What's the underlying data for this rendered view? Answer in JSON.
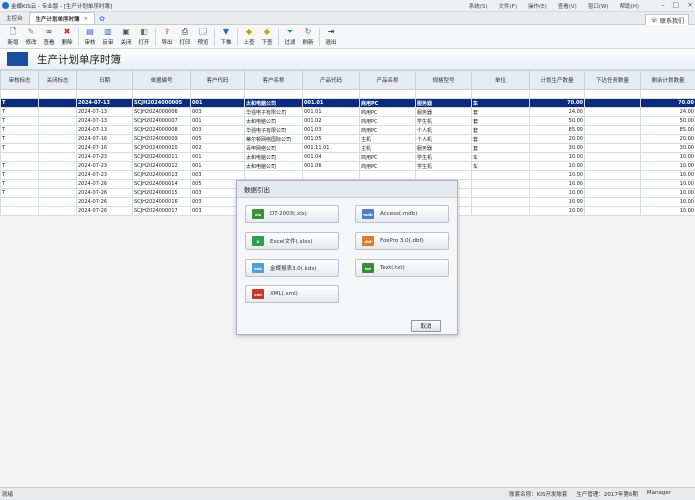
{
  "window": {
    "title": "金蝶KIS云 - 专业版 - [生产计划单序时簿]",
    "menus": [
      "系统(S)",
      "文件(F)",
      "操作(E)",
      "查看(V)",
      "窗口(W)",
      "帮助(H)"
    ]
  },
  "tabs": [
    {
      "label": "主控台",
      "active": false
    },
    {
      "label": "生产计划单序时簿",
      "active": true
    }
  ],
  "contact_label": "联系我们",
  "toolbar": {
    "buttons": [
      {
        "label": "新增",
        "icon": "new-document-icon"
      },
      {
        "label": "修改",
        "icon": "edit-icon"
      },
      {
        "label": "查看",
        "icon": "binoculars-icon"
      },
      {
        "label": "删除",
        "icon": "delete-icon"
      },
      {
        "label": "审核",
        "icon": "audit-icon"
      },
      {
        "label": "反审",
        "icon": "unaudit-icon"
      },
      {
        "label": "关闭",
        "icon": "close-doc-icon"
      },
      {
        "label": "打开",
        "icon": "open-doc-icon"
      },
      {
        "label": "导出",
        "icon": "export-icon"
      },
      {
        "label": "打印",
        "icon": "print-icon"
      },
      {
        "label": "预览",
        "icon": "preview-icon"
      },
      {
        "label": "下推",
        "icon": "push-down-icon"
      },
      {
        "label": "上查",
        "icon": "query-up-icon"
      },
      {
        "label": "下查",
        "icon": "query-down-icon"
      },
      {
        "label": "过滤",
        "icon": "filter-icon"
      },
      {
        "label": "刷新",
        "icon": "refresh-icon"
      },
      {
        "label": "退出",
        "icon": "exit-icon"
      }
    ]
  },
  "page_title": "生产计划单序时簿",
  "grid": {
    "columns": [
      "审核标志",
      "关闭标志",
      "日期",
      "单据编号",
      "客户代码",
      "客户名称",
      "产品代码",
      "产品名称",
      "规格型号",
      "单位",
      "计划生产数量",
      "下达任务数量",
      "剩余计划数量"
    ],
    "rows": [
      [
        "",
        "",
        "",
        "",
        "",
        "",
        "",
        "",
        "",
        "",
        "",
        "",
        ""
      ],
      [
        "T",
        "",
        "2024-07-13",
        "SCJH2024000005",
        "001",
        "太和电脑公司",
        "001.01",
        "商用PC",
        "服务器",
        "车",
        "70.00",
        "",
        "70.00"
      ],
      [
        "T",
        "",
        "2024-07-13",
        "SCJH2024000006",
        "003",
        "华强电子有限公司",
        "001.01",
        "商用PC",
        "服务器",
        "套",
        "24.00",
        "",
        "24.00"
      ],
      [
        "T",
        "",
        "2024-07-13",
        "SCJH2024000007",
        "001",
        "太和电脑公司",
        "001.02",
        "商用PC",
        "学生机",
        "套",
        "50.00",
        "",
        "50.00"
      ],
      [
        "T",
        "",
        "2024-07-13",
        "SCJH2024000008",
        "003",
        "华强电子有限公司",
        "001.03",
        "商用PC",
        "个人机",
        "套",
        "85.00",
        "",
        "85.00"
      ],
      [
        "T",
        "",
        "2024-07-16",
        "SCJH2024000009",
        "005",
        "蒂尔顿网络国际公司",
        "001.05",
        "主机",
        "个人机",
        "套",
        "20.00",
        "",
        "20.00"
      ],
      [
        "T",
        "",
        "2024-07-16",
        "SCJH2024000010",
        "002",
        "百甲网络公司",
        "001.11.01",
        "主机",
        "服务器",
        "套",
        "30.00",
        "",
        "30.00"
      ],
      [
        "",
        "",
        "2024-07-23",
        "SCJH2024000011",
        "001",
        "太和电脑公司",
        "001.04",
        "商用PC",
        "学生机",
        "车",
        "10.00",
        "",
        "10.00"
      ],
      [
        "T",
        "",
        "2024-07-23",
        "SCJH2024000012",
        "001",
        "太和电脑公司",
        "001.06",
        "商用PC",
        "学生机",
        "车",
        "10.00",
        "",
        "10.00"
      ],
      [
        "T",
        "",
        "2024-07-23",
        "SCJH2024000013",
        "003",
        "",
        "",
        "",
        "",
        "",
        "10.00",
        "",
        "10.00"
      ],
      [
        "T",
        "",
        "2024-07-26",
        "SCJH2024000014",
        "005",
        "",
        "",
        "",
        "",
        "",
        "10.00",
        "",
        "10.00"
      ],
      [
        "T",
        "",
        "2024-07-26",
        "SCJH2024000015",
        "003",
        "",
        "",
        "",
        "",
        "",
        "10.00",
        "",
        "10.00"
      ],
      [
        "",
        "",
        "2024-07-26",
        "SCJH2024000016",
        "003",
        "",
        "",
        "",
        "",
        "",
        "10.00",
        "",
        "10.00"
      ],
      [
        "",
        "",
        "2024-07-26",
        "SCJH2024000017",
        "003",
        "",
        "",
        "",
        "",
        "",
        "10.00",
        "",
        "10.00"
      ]
    ],
    "selected_row": 1
  },
  "dialog": {
    "title": "数据引出",
    "options": [
      {
        "label": "DT-2003(.xls)",
        "icon": "xls-file-icon",
        "badge": "xls",
        "color": "#3c8d3c"
      },
      {
        "label": "Access(.mdb)",
        "icon": "mdb-file-icon",
        "badge": "mdb",
        "color": "#4f7fc4"
      },
      {
        "label": "Excel文件(.xlsx)",
        "icon": "excel-file-icon",
        "badge": "X",
        "color": "#2e9d4f"
      },
      {
        "label": "FoxPro 3.0(.dbf)",
        "icon": "dbf-file-icon",
        "badge": "dbf",
        "color": "#e07a2a"
      },
      {
        "label": "金蝶报表3.0(.kds)",
        "icon": "kds-file-icon",
        "badge": "kds",
        "color": "#4aa0d8"
      },
      {
        "label": "Text(.txt)",
        "icon": "txt-file-icon",
        "badge": "txt",
        "color": "#3a8a3a"
      },
      {
        "label": "XML(.xml)",
        "icon": "xml-file-icon",
        "badge": "xml",
        "color": "#c0392b"
      }
    ],
    "cancel_label": "取消"
  },
  "statusbar": {
    "left": "就绪",
    "account": "账套名称：KIS开发账套",
    "period": "生产管理：2017年第6期",
    "user": "Manager"
  }
}
